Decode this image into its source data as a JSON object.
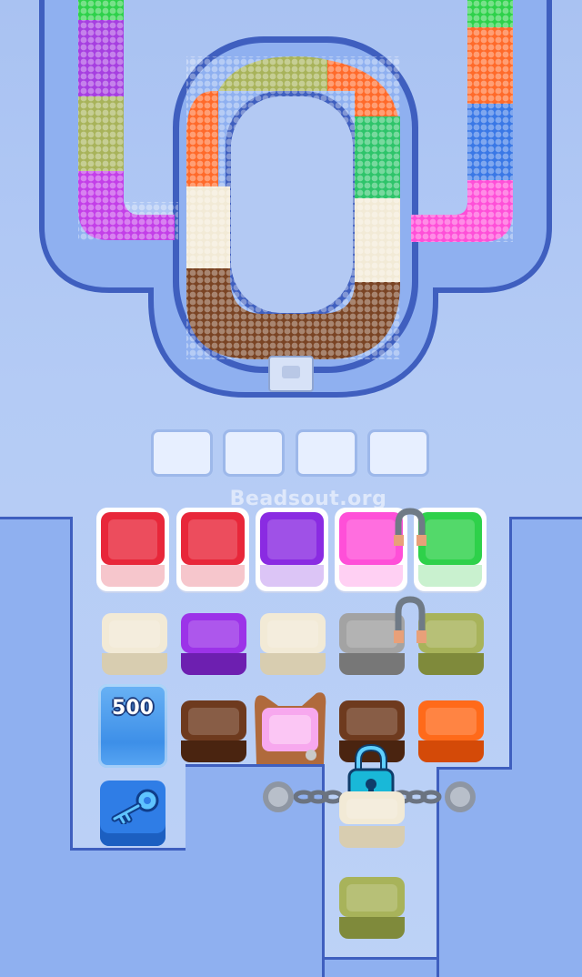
{
  "watermark": "Beadsout.org",
  "slots": {
    "count": 4
  },
  "ice_block": {
    "label": "500"
  },
  "icons": [
    "magnet-icon",
    "lock-icon",
    "key-icon",
    "chain-icon",
    "bag-icon"
  ],
  "colors": {
    "red": "#e8273a",
    "purple": "#8a2be2",
    "pink": "#ff4fd8",
    "green": "#2ed14a",
    "cream": "#f2ead6",
    "gray": "#9c9c9c",
    "olive": "#a8b35a",
    "brown": "#6e3a1e",
    "orange": "#ff6a1a",
    "blue": "#2f7de6"
  },
  "grid": {
    "row1": [
      "red",
      "red",
      "purple",
      "pink",
      "green"
    ],
    "row2": [
      "cream",
      "purple",
      "cream",
      "gray",
      "olive"
    ],
    "row3": [
      "ice",
      "brown",
      "pink-bag",
      "brown",
      "orange"
    ],
    "row4": [
      "key",
      "",
      "",
      "cream",
      ""
    ],
    "row5": [
      "",
      "",
      "",
      "olive",
      ""
    ]
  }
}
